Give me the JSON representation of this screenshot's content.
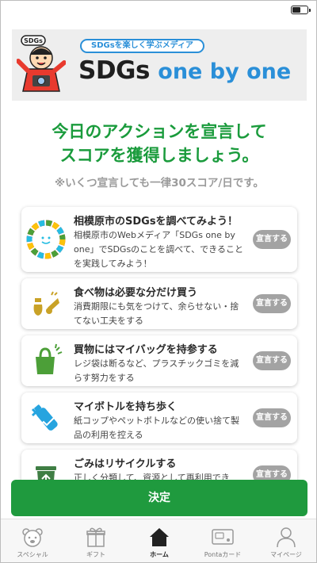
{
  "banner": {
    "tagline": "SDGsを楽しく学ぶメディア",
    "brand_main": "SDGs",
    "brand_sub": "one by one",
    "mascot_badge": "SDGs"
  },
  "headline": {
    "line1": "今日のアクションを宣言して",
    "line2": "スコアを獲得しましょう。"
  },
  "note": "※いくつ宣言しても一律30スコア/日です。",
  "actions": [
    {
      "title": "相模原市のSDGsを調べてみよう！",
      "description": "相模原市のWebメディア「SDGs one by one」でSDGsのことを調べて、できることを実践してみよう！",
      "button": "宣言する",
      "icon": "sdgs-wheel-icon"
    },
    {
      "title": "食べ物は必要な分だけ買う",
      "description": "消費期限にも気をつけて、余らせない・捨てない工夫をする",
      "button": "宣言する",
      "icon": "food-icon"
    },
    {
      "title": "買物にはマイバッグを持参する",
      "description": "レジ袋は断るなど、プラスチックゴミを減らす努力をする",
      "button": "宣言する",
      "icon": "shopping-bag-icon"
    },
    {
      "title": "マイボトルを持ち歩く",
      "description": "紙コップやペットボトルなどの使い捨て製品の利用を控える",
      "button": "宣言する",
      "icon": "bottle-icon"
    },
    {
      "title": "ごみはリサイクルする",
      "description": "正しく分類して、資源として再利用でき",
      "button": "宣言する",
      "icon": "recycle-bin-icon"
    }
  ],
  "cta_label": "決定",
  "tabs": [
    {
      "label": "スペシャル",
      "icon": "bear-icon"
    },
    {
      "label": "ギフト",
      "icon": "gift-icon"
    },
    {
      "label": "ホーム",
      "icon": "home-icon"
    },
    {
      "label": "Pontaカード",
      "icon": "card-icon"
    },
    {
      "label": "マイページ",
      "icon": "person-icon"
    }
  ],
  "colors": {
    "accent_green": "#1f9a3e",
    "brand_blue": "#2a8fd8",
    "declare_button": "#a3a3a3"
  }
}
